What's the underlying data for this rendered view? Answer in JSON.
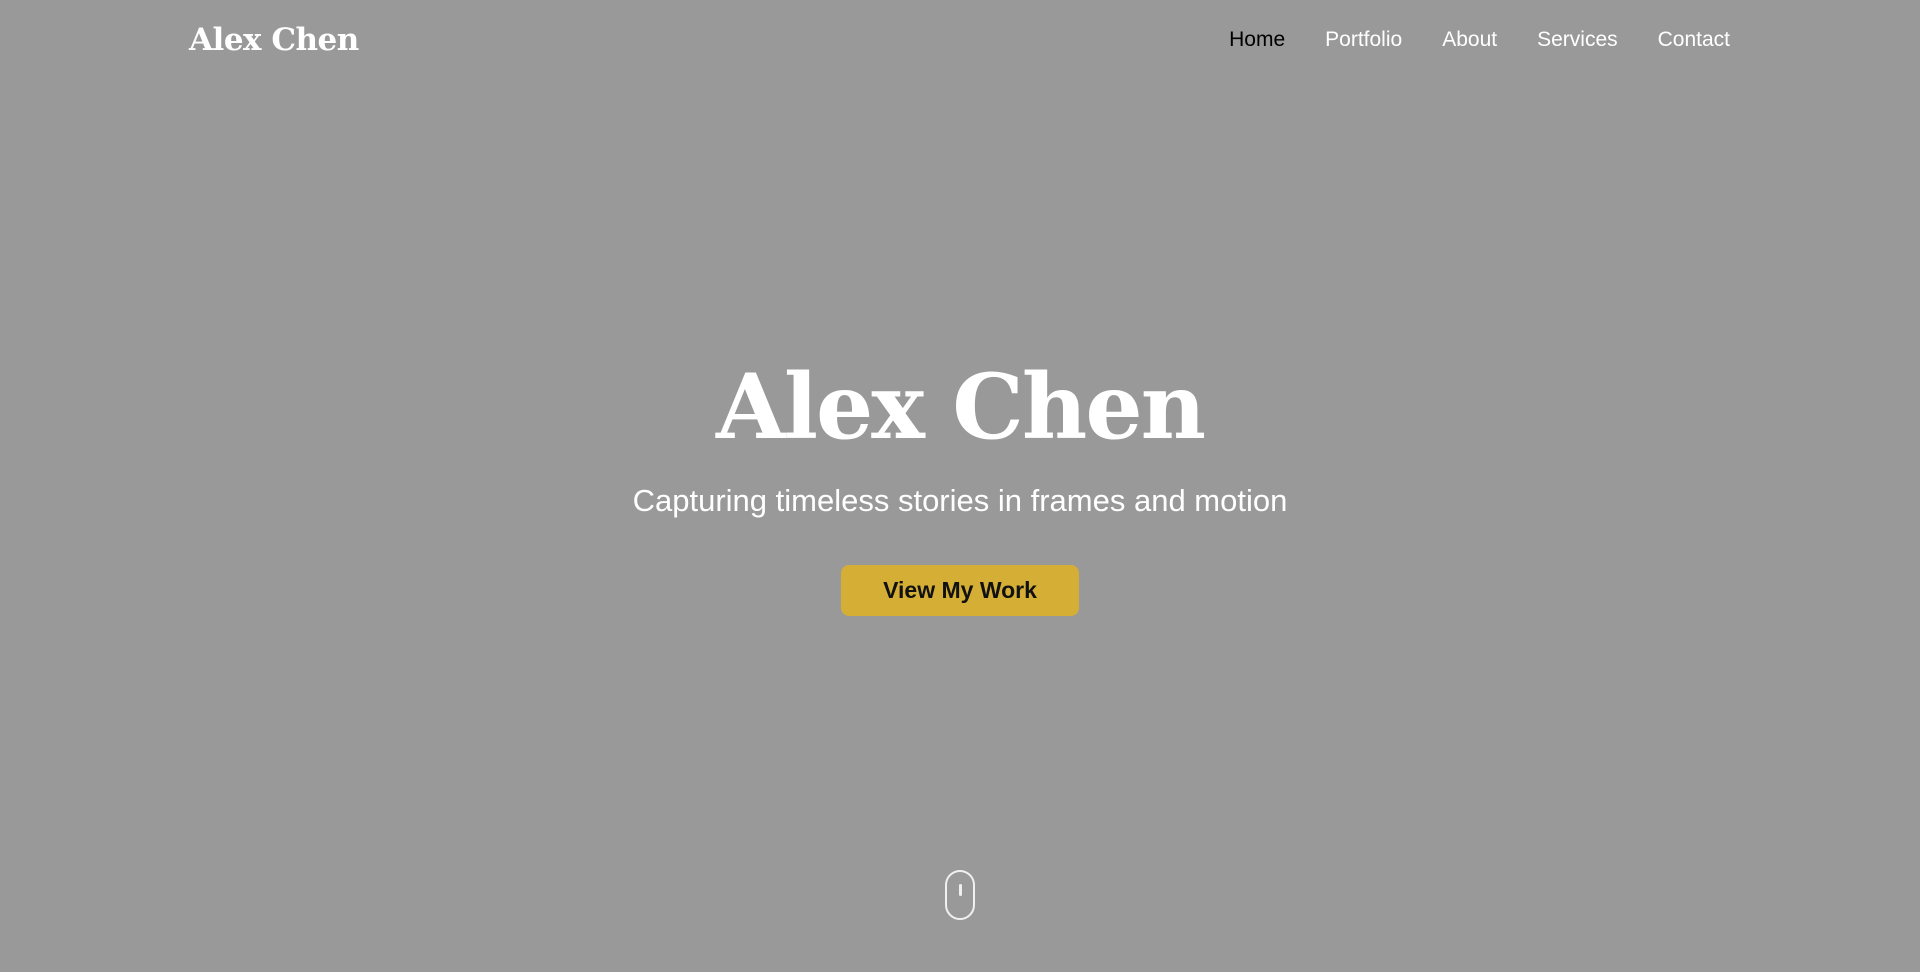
{
  "header": {
    "logo": "Alex Chen",
    "nav": {
      "home": "Home",
      "portfolio": "Portfolio",
      "about": "About",
      "services": "Services",
      "contact": "Contact"
    },
    "active_item": "Home"
  },
  "hero": {
    "title": "Alex Chen",
    "subtitle": "Capturing timeless stories in frames and motion",
    "cta_label": "View My Work"
  },
  "scroll_indicator": {
    "icon": "mouse-scroll-icon"
  },
  "colors": {
    "background": "#999999",
    "accent": "#d4ae35",
    "text": "#ffffff",
    "active_nav": "#000000"
  }
}
